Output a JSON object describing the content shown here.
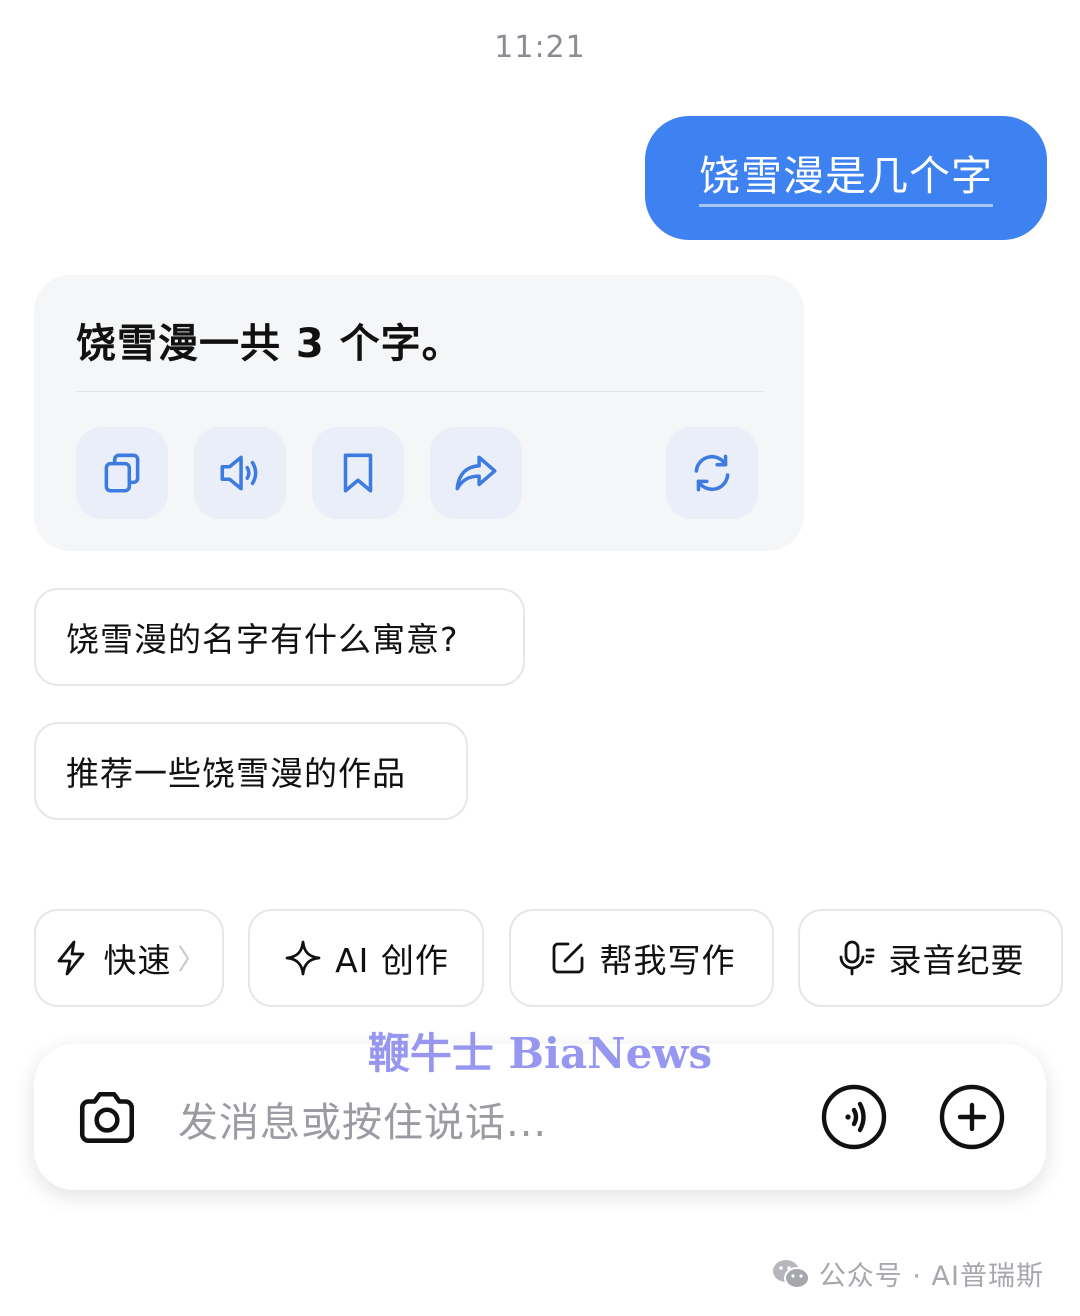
{
  "status": {
    "time": "11:21"
  },
  "user_message": {
    "text": "饶雪漫是几个字"
  },
  "ai_message": {
    "text": "饶雪漫一共 3 个字。",
    "actions": [
      {
        "icon": "copy-icon"
      },
      {
        "icon": "speaker-icon"
      },
      {
        "icon": "bookmark-icon"
      },
      {
        "icon": "share-icon"
      },
      {
        "icon": "regenerate-icon"
      }
    ]
  },
  "suggestions": [
    "饶雪漫的名字有什么寓意?",
    "推荐一些饶雪漫的作品"
  ],
  "tools": [
    {
      "label": "快速",
      "icon": "lightning-icon",
      "chevron": "〉"
    },
    {
      "label": "AI 创作",
      "icon": "sparkle-icon"
    },
    {
      "label": "帮我写作",
      "icon": "edit-icon"
    },
    {
      "label": "录音纪要",
      "icon": "microphone-icon"
    }
  ],
  "input": {
    "placeholder": "发消息或按住说话..."
  },
  "watermarks": {
    "center": "鞭牛士 BiaNews",
    "footer": "公众号 · AI普瑞斯"
  },
  "colors": {
    "accent": "#3d82f0",
    "icon_blue": "#3d7be0",
    "action_bg": "#e9eef8",
    "card_bg": "#f5f6f8"
  }
}
